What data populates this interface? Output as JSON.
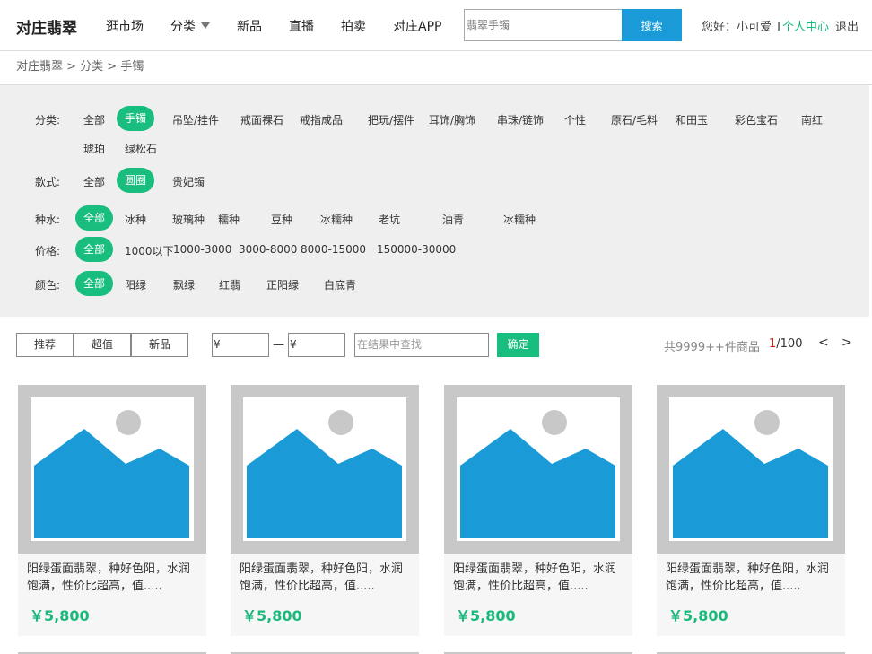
{
  "header": {
    "logo": "对庄翡翠",
    "nav": [
      "逛市场",
      "分类",
      "新品",
      "直播",
      "拍卖",
      "对庄APP"
    ],
    "search_placeholder": "翡翠手镯",
    "search_button": "搜索",
    "greeting": "您好：",
    "username": "小可爱",
    "separator": "I",
    "personal_center": "个人中心",
    "logout": "退出"
  },
  "breadcrumb": "对庄翡翠 > 分类 > 手镯",
  "filters": {
    "category": {
      "label": "分类:",
      "options": [
        "全部",
        "手镯",
        "吊坠/挂件",
        "戒面裸石",
        "戒指成品",
        "把玩/摆件",
        "耳饰/胸饰",
        "串珠/链饰",
        "个性",
        "原石/毛料",
        "和田玉",
        "彩色宝石",
        "南红",
        "琥珀",
        "绿松石"
      ],
      "active": "手镯"
    },
    "style": {
      "label": "款式:",
      "options": [
        "全部",
        "圆圈",
        "贵妃镯"
      ],
      "active": "圆圈"
    },
    "variety": {
      "label": "种水:",
      "options": [
        "全部",
        "冰种",
        "玻璃种",
        "糯种",
        "豆种",
        "冰糯种",
        "老坑",
        "油青",
        "冰糯种"
      ],
      "active": "全部"
    },
    "price": {
      "label": "价格:",
      "options": [
        "全部",
        "1000以下",
        "1000-3000",
        "3000-8000",
        "8000-15000",
        "150000-30000"
      ],
      "active": "全部"
    },
    "color": {
      "label": "颜色:",
      "options": [
        "全部",
        "阳绿",
        "飘绿",
        "红翡",
        "正阳绿",
        "白底青"
      ],
      "active": "全部"
    }
  },
  "toolbar": {
    "sort_buttons": [
      "推荐",
      "超值",
      "新品"
    ],
    "price_min": "¥",
    "price_dash": "—",
    "price_max": "¥",
    "find_placeholder": "在结果中查找",
    "confirm": "确定",
    "total": "共9999++件商品",
    "page_current": "1",
    "page_total": "/100",
    "prev": "<",
    "next": ">"
  },
  "products": [
    {
      "name": "阳绿蛋面翡翠，种好色阳，水润饱满，性价比超高，值.....",
      "price": "￥5,800"
    },
    {
      "name": "阳绿蛋面翡翠，种好色阳，水润饱满，性价比超高，值.....",
      "price": "￥5,800"
    },
    {
      "name": "阳绿蛋面翡翠，种好色阳，水润饱满，性价比超高，值.....",
      "price": "￥5,800"
    },
    {
      "name": "阳绿蛋面翡翠，种好色阳，水润饱满，性价比超高，值.....",
      "price": "￥5,800"
    }
  ],
  "colors": {
    "accent_green": "#19be7f",
    "search_blue": "#1a9bd7",
    "image_blue": "#1a9bd7",
    "page_red": "#d01a1a"
  },
  "icons": {
    "nav_dropdown": "caret-down-icon",
    "product_image": "image-placeholder-icon"
  }
}
